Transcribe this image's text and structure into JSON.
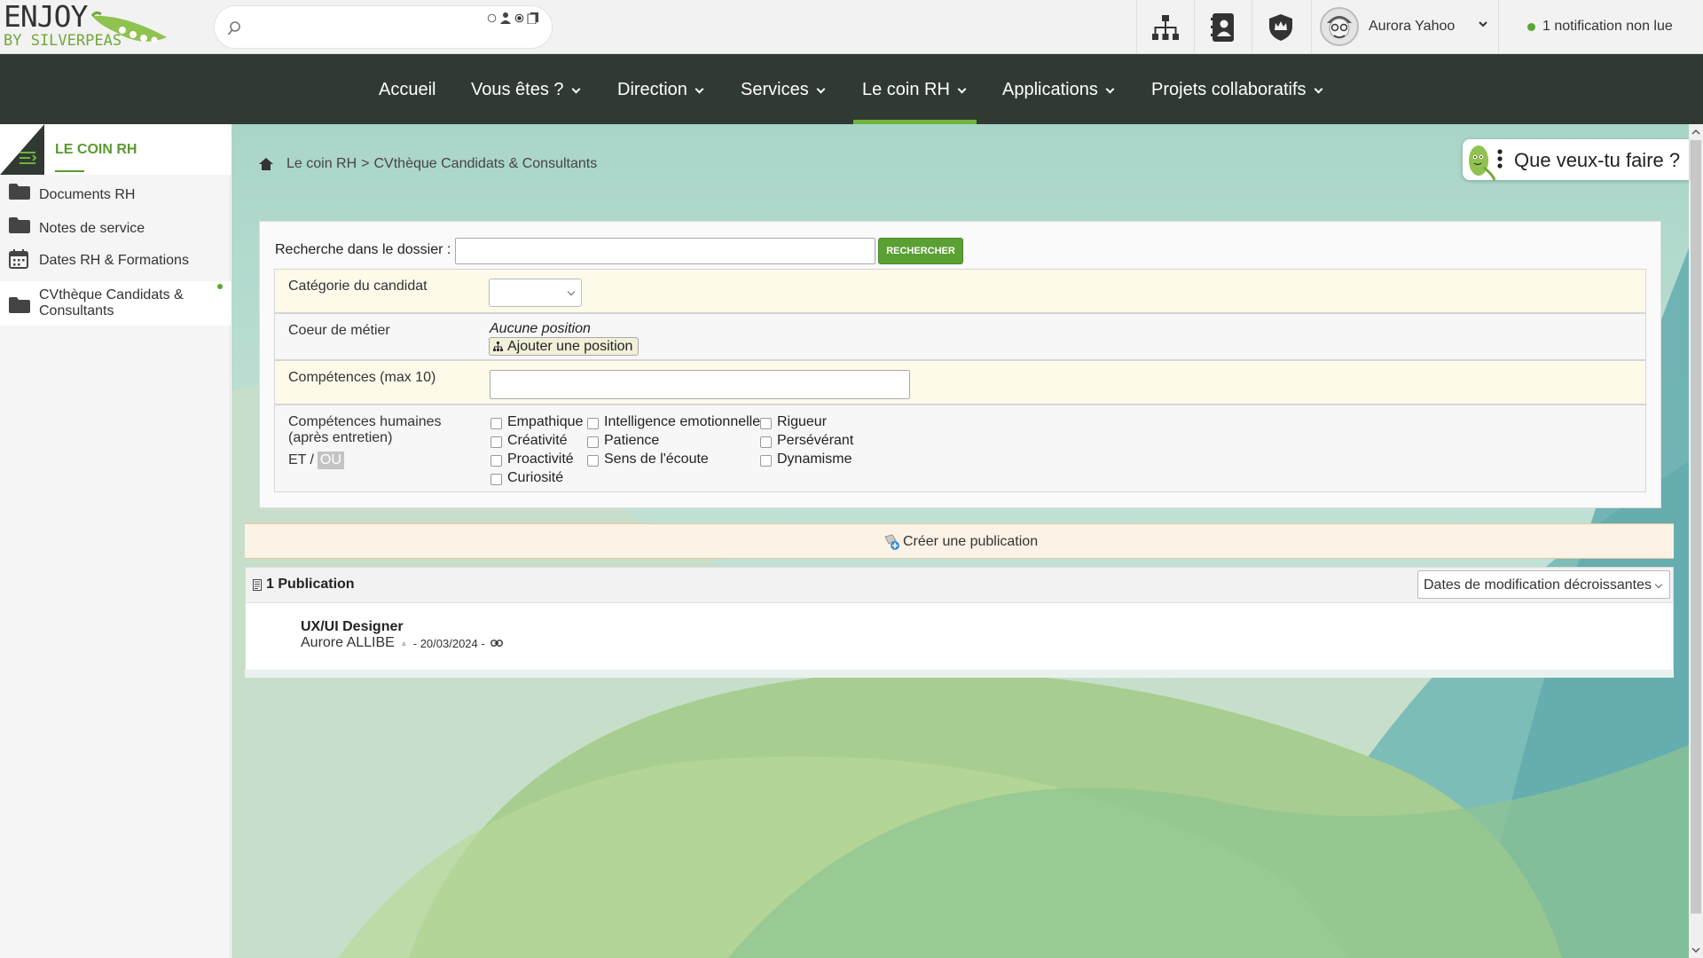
{
  "logo": {
    "line1": "ENJOY",
    "line2": "BY SILVERPEAS"
  },
  "topbar": {
    "icons": [
      "org-chart-icon",
      "directory-icon",
      "admin-shield-icon"
    ],
    "user_name": "Aurora Yahoo",
    "notification": "1 notification non lue"
  },
  "nav": {
    "items": [
      {
        "label": "Accueil"
      },
      {
        "label": "Vous êtes ?"
      },
      {
        "label": "Direction"
      },
      {
        "label": "Services"
      },
      {
        "label": "Le coin RH"
      },
      {
        "label": "Applications"
      },
      {
        "label": "Projets collaboratifs"
      }
    ],
    "active": "Le coin RH"
  },
  "sidebar": {
    "title": "LE COIN RH",
    "items": [
      {
        "label": "Documents RH",
        "icon": "folder-icon"
      },
      {
        "label": "Notes de service",
        "icon": "folder-icon"
      },
      {
        "label": "Dates RH & Formations",
        "icon": "calendar-icon"
      },
      {
        "label": "CVthèque Candidats & Consultants",
        "icon": "folder-icon",
        "active": true
      }
    ]
  },
  "breadcrumb": {
    "root": "Le coin RH",
    "sep": ">",
    "current": "CVthèque Candidats & Consultants"
  },
  "help": {
    "label": "Que veux-tu faire ?"
  },
  "search": {
    "label": "Recherche dans le dossier :",
    "value": "",
    "button": "RECHERCHER"
  },
  "filters": {
    "categorie": {
      "label": "Catégorie du candidat",
      "value": ""
    },
    "coeur": {
      "label": "Coeur de métier",
      "empty_text": "Aucune position",
      "add_button": "Ajouter une position"
    },
    "competences": {
      "label": "Compétences (max 10)",
      "value": ""
    },
    "humaines": {
      "label_line1": "Compétences humaines",
      "label_line2": "(après entretien)",
      "et": "ET",
      "slash": "/",
      "ou": "OU",
      "options": [
        "Empathique",
        "Intelligence emotionnelle",
        "Rigueur",
        "Créativité",
        "Patience",
        "Persévérant",
        "Proactivité",
        "Sens de l'écoute",
        "Dynamisme",
        "Curiosité"
      ]
    }
  },
  "create": {
    "label": "Créer une publication"
  },
  "publications": {
    "count_label": "1 Publication",
    "sort_value": "Dates de modification décroissantes",
    "items": [
      {
        "title": "UX/UI Designer",
        "author": "Aurore ALLIBE",
        "date": "- 20/03/2024 -"
      }
    ]
  }
}
